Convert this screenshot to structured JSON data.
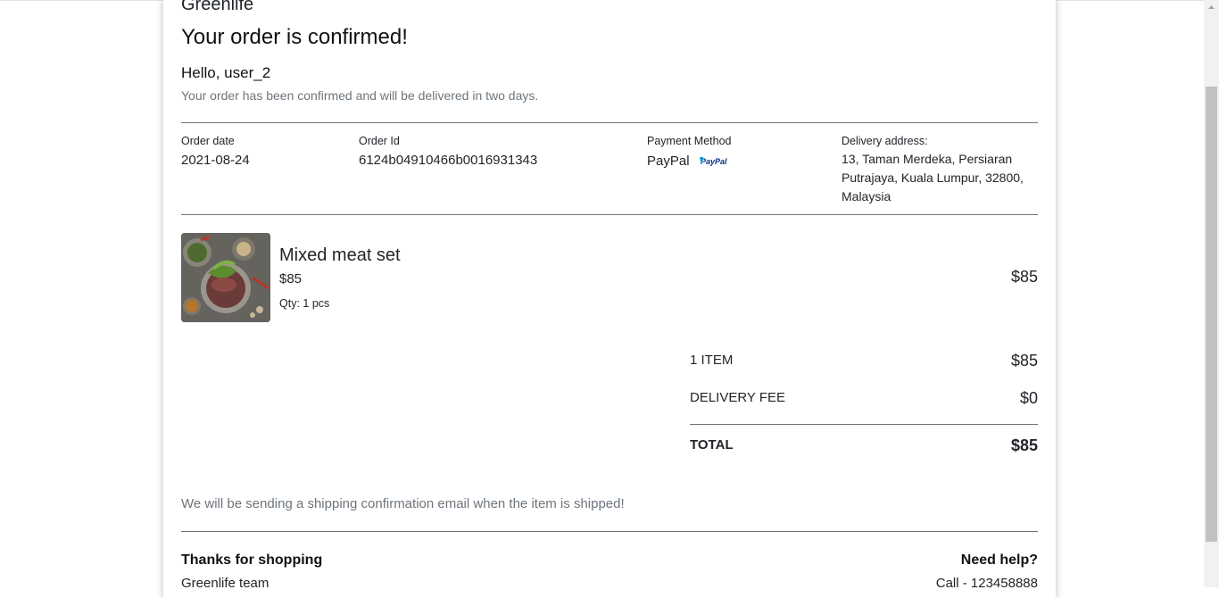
{
  "brand": "Greenlife",
  "title": "Your order is confirmed!",
  "greeting": "Hello, user_2",
  "subtext": "Your order has been confirmed and will be delivered in two days.",
  "order": {
    "date_label": "Order date",
    "date_value": "2021-08-24",
    "id_label": "Order Id",
    "id_value": "6124b04910466b0016931343",
    "payment_label": "Payment Method",
    "payment_value": "PayPal",
    "payment_logo_text": "PayPal",
    "address_label": "Delivery address:",
    "address_value": "13, Taman Merdeka, Persiaran Putrajaya, Kuala Lumpur, 32800, Malaysia"
  },
  "item": {
    "name": "Mixed meat set",
    "price": "$85",
    "qty": "Qty: 1 pcs",
    "line_total": "$85"
  },
  "summary": {
    "items_label": "1 ITEM",
    "items_value": "$85",
    "delivery_label": "DELIVERY FEE",
    "delivery_value": "$0",
    "total_label": "TOTAL",
    "total_value": "$85"
  },
  "note": "We will be sending a shipping confirmation email when the item is shipped!",
  "footer": {
    "thanks": "Thanks for shopping",
    "team": "Greenlife team",
    "help": "Need help?",
    "call": "Call - 123458888"
  },
  "colors": {
    "muted_text": "#6c757d",
    "paypal_dark": "#003087",
    "paypal_light": "#009cde"
  }
}
